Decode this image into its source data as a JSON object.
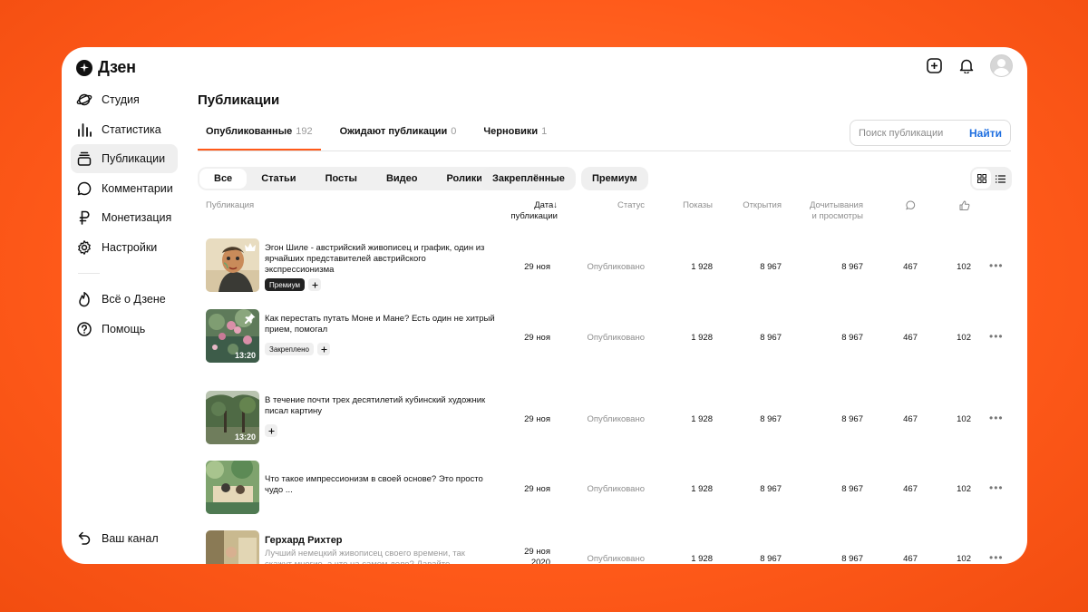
{
  "app": {
    "logo_text": "Дзен"
  },
  "topbar": {
    "icons": [
      "add-icon",
      "bell-icon",
      "avatar"
    ]
  },
  "sidebar": {
    "items": [
      {
        "label": "Студия",
        "icon": "planet-icon",
        "active": false
      },
      {
        "label": "Статистика",
        "icon": "bar-chart-icon",
        "active": false
      },
      {
        "label": "Публикации",
        "icon": "stack-icon",
        "active": true
      },
      {
        "label": "Комментарии",
        "icon": "comment-icon",
        "active": false
      },
      {
        "label": "Монетизация",
        "icon": "ruble-icon",
        "active": false
      },
      {
        "label": "Настройки",
        "icon": "gear-icon",
        "active": false
      }
    ],
    "secondary": [
      {
        "label": "Всё о Дзене",
        "icon": "flame-icon"
      },
      {
        "label": "Помощь",
        "icon": "help-icon"
      }
    ],
    "bottom": {
      "label": "Ваш канал",
      "icon": "back-arrow-icon"
    }
  },
  "page": {
    "title": "Публикации"
  },
  "tabs": [
    {
      "label": "Опубликованные",
      "count": "192",
      "active": true
    },
    {
      "label": "Ожидают публикации",
      "count": "0",
      "active": false
    },
    {
      "label": "Черновики",
      "count": "1",
      "active": false
    }
  ],
  "search": {
    "placeholder": "Поиск публикации",
    "button": "Найти"
  },
  "filters": {
    "segments": [
      "Все",
      "Статьи",
      "Посты",
      "Видео",
      "Ролики"
    ],
    "active_segment": "Все",
    "pinned": "Закреплённые",
    "premium": "Премиум"
  },
  "table": {
    "headers": {
      "publication": "Публикация",
      "date_line1": "Дата↓",
      "date_line2": "публикации",
      "status": "Статус",
      "views": "Показы",
      "opens": "Открытия",
      "reads_line1": "Дочитывания",
      "reads_line2": "и просмотры"
    },
    "rows": [
      {
        "title": "Эгон Шиле - австрийский живописец и график, один из ярчайших представителей австрийского экспрессионизма",
        "tag": "Премиум",
        "tag_style": "dark",
        "thumb_badge": "crown-icon",
        "duration": "",
        "date": "29 ноя",
        "status": "Опубликовано",
        "views": "1 928",
        "opens": "8 967",
        "reads": "8 967",
        "comments": "467",
        "likes": "102"
      },
      {
        "title": "Как перестать путать Моне и Мане? Есть один не хитрый прием, помогал",
        "tag": "Закреплено",
        "tag_style": "light",
        "thumb_badge": "pin-icon",
        "duration": "13:20",
        "date": "29 ноя",
        "status": "Опубликовано",
        "views": "1 928",
        "opens": "8 967",
        "reads": "8 967",
        "comments": "467",
        "likes": "102"
      },
      {
        "title": "В течение почти трех десятилетий кубинский художник писал картину",
        "tag": "",
        "tag_style": "",
        "thumb_badge": "",
        "duration": "13:20",
        "date": "29 ноя",
        "status": "Опубликовано",
        "views": "1 928",
        "opens": "8 967",
        "reads": "8 967",
        "comments": "467",
        "likes": "102"
      },
      {
        "title": "Что такое импрессионизм в своей основе? Это просто чудо ...",
        "tag": "",
        "tag_style": "",
        "thumb_badge": "",
        "duration": "",
        "date": "29 ноя",
        "status": "Опубликовано",
        "views": "1 928",
        "opens": "8 967",
        "reads": "8 967",
        "comments": "467",
        "likes": "102"
      },
      {
        "title": "Герхард Рихтер",
        "subtitle": "Лучший немецкий живописец своего времени, так скажут многие, а что на самом деле? Давайте",
        "tag": "",
        "tag_style": "",
        "thumb_badge": "",
        "duration": "",
        "date": "29 ноя",
        "date_year": "2020",
        "status": "Опубликовано",
        "views": "1 928",
        "opens": "8 967",
        "reads": "8 967",
        "comments": "467",
        "likes": "102"
      }
    ]
  },
  "colors": {
    "accent": "#ff5a1a",
    "link": "#1f6fe0",
    "background": "#ff6a25"
  }
}
